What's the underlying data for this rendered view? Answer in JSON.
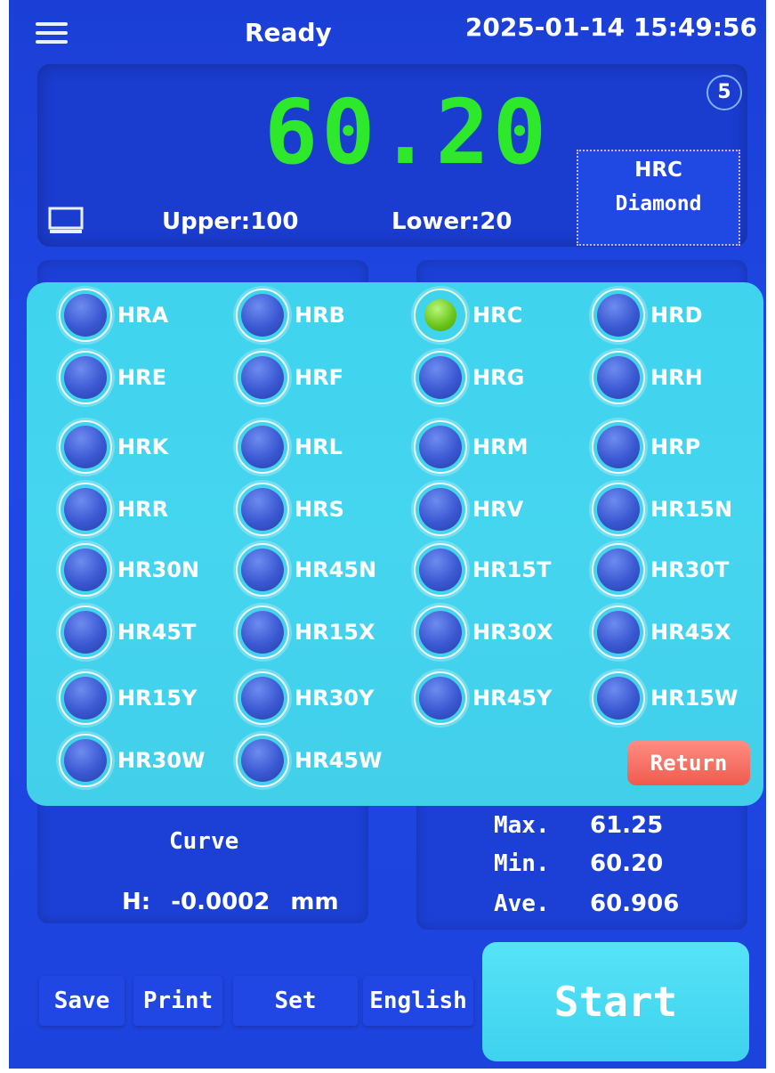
{
  "header": {
    "status": "Ready",
    "datetime": "2025-01-14  15:49:56"
  },
  "reading": {
    "value": "60.20",
    "count": "5",
    "upper": "Upper:100",
    "lower": "Lower:20",
    "mode_scale": "HRC",
    "mode_indenter": "Diamond"
  },
  "scales": [
    "HRA",
    "HRB",
    "HRC",
    "HRD",
    "HRE",
    "HRF",
    "HRG",
    "HRH",
    "HRK",
    "HRL",
    "HRM",
    "HRP",
    "HRR",
    "HRS",
    "HRV",
    "HR15N",
    "HR30N",
    "HR45N",
    "HR15T",
    "HR30T",
    "HR45T",
    "HR15X",
    "HR30X",
    "HR45X",
    "HR15Y",
    "HR30Y",
    "HR45Y",
    "HR15W",
    "HR30W",
    "HR45W"
  ],
  "selected_scale": "HRC",
  "popup": {
    "return_label": "Return"
  },
  "curve": {
    "label": "Curve",
    "h_key": "H:",
    "h_value": "-0.0002",
    "h_unit": "mm"
  },
  "stats": {
    "max_label": "Max.",
    "max_value": "61.25",
    "min_label": "Min.",
    "min_value": "60.20",
    "ave_label": "Ave.",
    "ave_value": "60.906"
  },
  "buttons": {
    "save": "Save",
    "print": "Print",
    "set": "Set",
    "language": "English",
    "start": "Start"
  },
  "colors": {
    "screen": "#1d43dd",
    "reading": "#2ee82b",
    "popup": "#45d5ef",
    "return": "#f05a4e",
    "start": "#4ad9f2"
  },
  "icons": {
    "menu": "hamburger-menu-icon",
    "display": "monitor-icon"
  }
}
